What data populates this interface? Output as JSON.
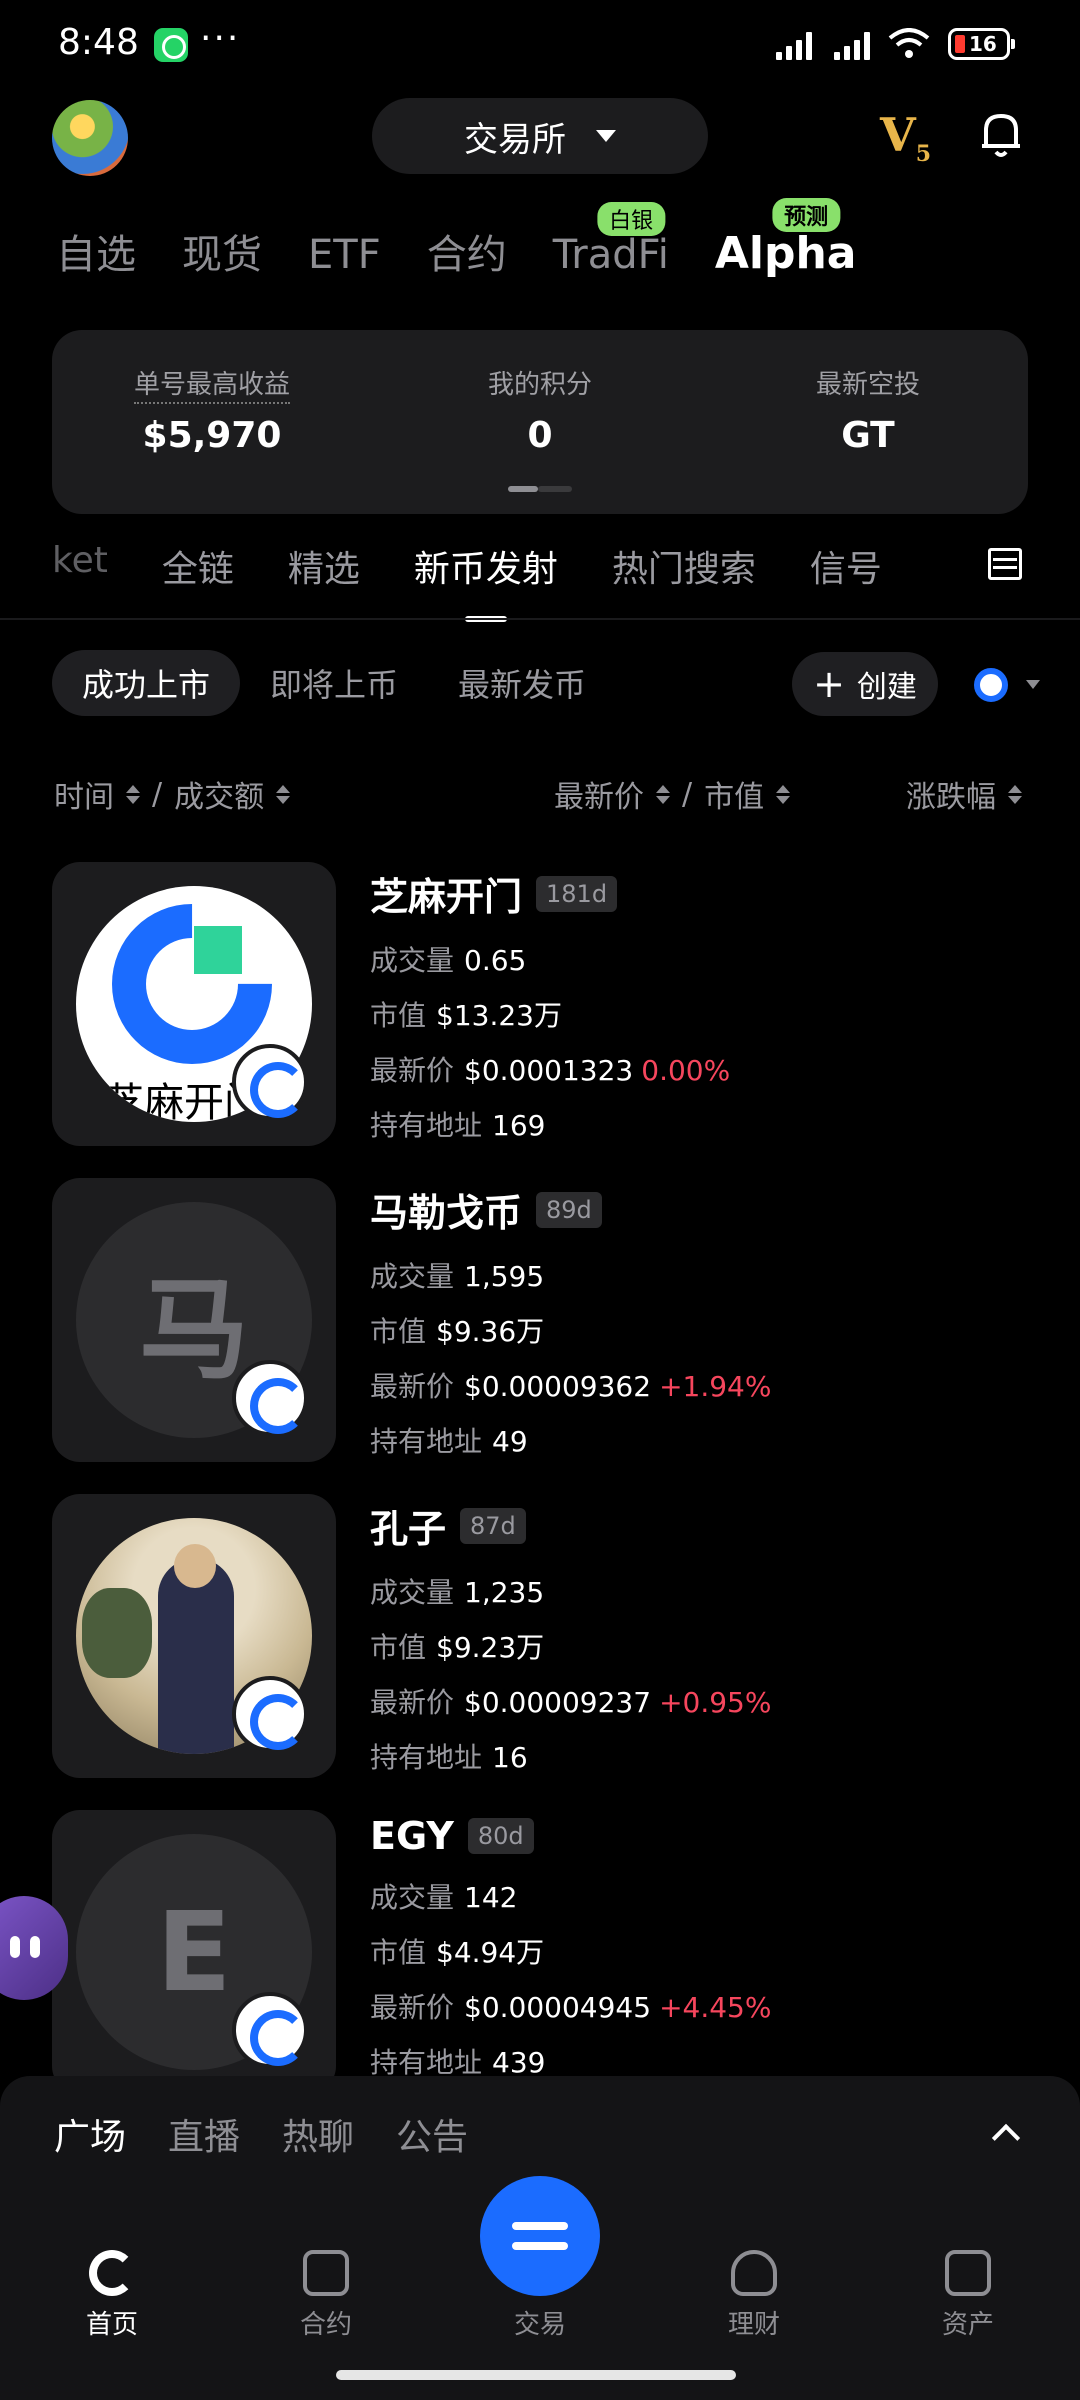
{
  "status_bar": {
    "time": "8:48",
    "more": "···",
    "battery": "16"
  },
  "header": {
    "exchange_label": "交易所",
    "vip": "V",
    "vip_level": "5"
  },
  "top_tabs": [
    {
      "label": "自选"
    },
    {
      "label": "现货"
    },
    {
      "label": "ETF"
    },
    {
      "label": "合约"
    },
    {
      "label": "TradFi",
      "badge": "白银"
    },
    {
      "label": "Alpha",
      "badge": "预测",
      "active": true
    }
  ],
  "stats": {
    "max_profit_label": "单号最高收益",
    "max_profit_value": "$5,970",
    "points_label": "我的积分",
    "points_value": "0",
    "airdrop_label": "最新空投",
    "airdrop_value": "GT"
  },
  "category_tabs": [
    "ket",
    "全链",
    "精选",
    "新币发射",
    "热门搜索",
    "信号"
  ],
  "active_category": "新币发射",
  "filters": [
    "成功上市",
    "即将上币",
    "最新发币"
  ],
  "create_label": "创建",
  "sort": {
    "time": "时间",
    "sep1": "/",
    "volume": "成交额",
    "price": "最新价",
    "sep2": "/",
    "mcap": "市值",
    "change": "涨跌幅"
  },
  "row_labels": {
    "volume": "成交量",
    "mcap": "市值",
    "price": "最新价",
    "holders": "持有地址"
  },
  "tokens": [
    {
      "name": "芝麻开门",
      "age": "181d",
      "logo_text": "芝麻开门",
      "volume": "0.65",
      "mcap": "$13.23万",
      "price": "$0.0001323",
      "change": "0.00%",
      "holders": "169"
    },
    {
      "name": "马勒戈币",
      "age": "89d",
      "logo_text": "马",
      "volume": "1,595",
      "mcap": "$9.36万",
      "price": "$0.00009362",
      "change": "+1.94%",
      "holders": "49"
    },
    {
      "name": "孔子",
      "age": "87d",
      "volume": "1,235",
      "mcap": "$9.23万",
      "price": "$0.00009237",
      "change": "+0.95%",
      "holders": "16"
    },
    {
      "name": "EGY",
      "age": "80d",
      "logo_text": "E",
      "volume": "142",
      "mcap": "$4.94万",
      "price": "$0.00004945",
      "change": "+4.45%",
      "holders": "439"
    }
  ],
  "feed_tabs": [
    "广场",
    "直播",
    "热聊",
    "公告"
  ],
  "bottom_nav": {
    "home": "首页",
    "futures": "合约",
    "trade": "交易",
    "earn": "理财",
    "assets": "资产"
  },
  "colors": {
    "accent": "#1b6cff",
    "down": "#f6465d",
    "badge": "#89e06b",
    "vip": "#e8b54a"
  }
}
